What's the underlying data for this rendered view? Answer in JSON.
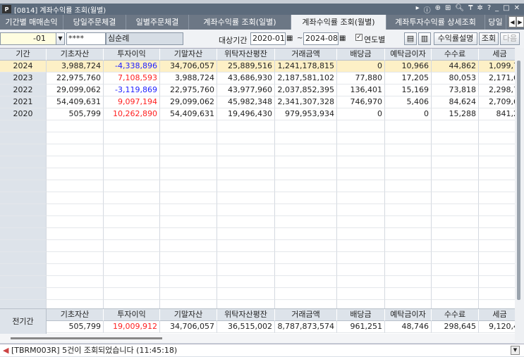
{
  "window": {
    "title": "[0814] 계좌수익률 조회(월별)",
    "logo": "P"
  },
  "tabs": [
    "기간별 매매손익",
    "당일주문체결",
    "일별주문체결",
    "계좌수익률 조회(일별)",
    "계좌수익률 조회(월별)",
    "계좌투자수익률 상세조회",
    "당일"
  ],
  "toolbar": {
    "account": "-01",
    "password": "****",
    "name": "심순례",
    "period_label": "대상기간",
    "start": "2020-01",
    "tilde": "~",
    "end": "2024-08",
    "yearly_label": "연도별",
    "yearly_checked": true,
    "explain_btn": "수익률설명",
    "query_btn": "조회",
    "next_btn": "다음"
  },
  "grid": {
    "headers": [
      "기간",
      "기초자산",
      "투자이익",
      "기말자산",
      "위탁자산평잔",
      "거래금액",
      "배당금",
      "예탁금이자",
      "수수료",
      "세금"
    ],
    "rows": [
      [
        "2024",
        "3,988,724",
        "-4,338,896",
        "34,706,057",
        "25,889,516",
        "1,241,178,815",
        "0",
        "10,966",
        "44,862",
        "1,099,7"
      ],
      [
        "2023",
        "22,975,760",
        "7,108,593",
        "3,988,724",
        "43,686,930",
        "2,187,581,102",
        "77,880",
        "17,205",
        "80,053",
        "2,171,6"
      ],
      [
        "2022",
        "29,099,062",
        "-3,119,869",
        "22,975,760",
        "43,977,960",
        "2,037,852,395",
        "136,401",
        "15,169",
        "73,818",
        "2,298,7"
      ],
      [
        "2021",
        "54,409,631",
        "9,097,194",
        "29,099,062",
        "45,982,348",
        "2,341,307,328",
        "746,970",
        "5,406",
        "84,624",
        "2,709,6"
      ],
      [
        "2020",
        "505,799",
        "10,262,890",
        "54,409,631",
        "19,496,430",
        "979,953,934",
        "0",
        "0",
        "15,288",
        "841,2"
      ]
    ]
  },
  "total": {
    "label": "전기간",
    "values": [
      "505,799",
      "19,009,912",
      "34,706,057",
      "36,515,002",
      "8,787,873,574",
      "961,251",
      "48,746",
      "298,645",
      "9,120,4"
    ]
  },
  "status": {
    "message": "[TBRM003R] 5건이 조회되었습니다 (11:45:18)"
  },
  "colors": {
    "negative": "#2020ff",
    "positive": "#ff2020",
    "selected": "#fdf0c6"
  }
}
